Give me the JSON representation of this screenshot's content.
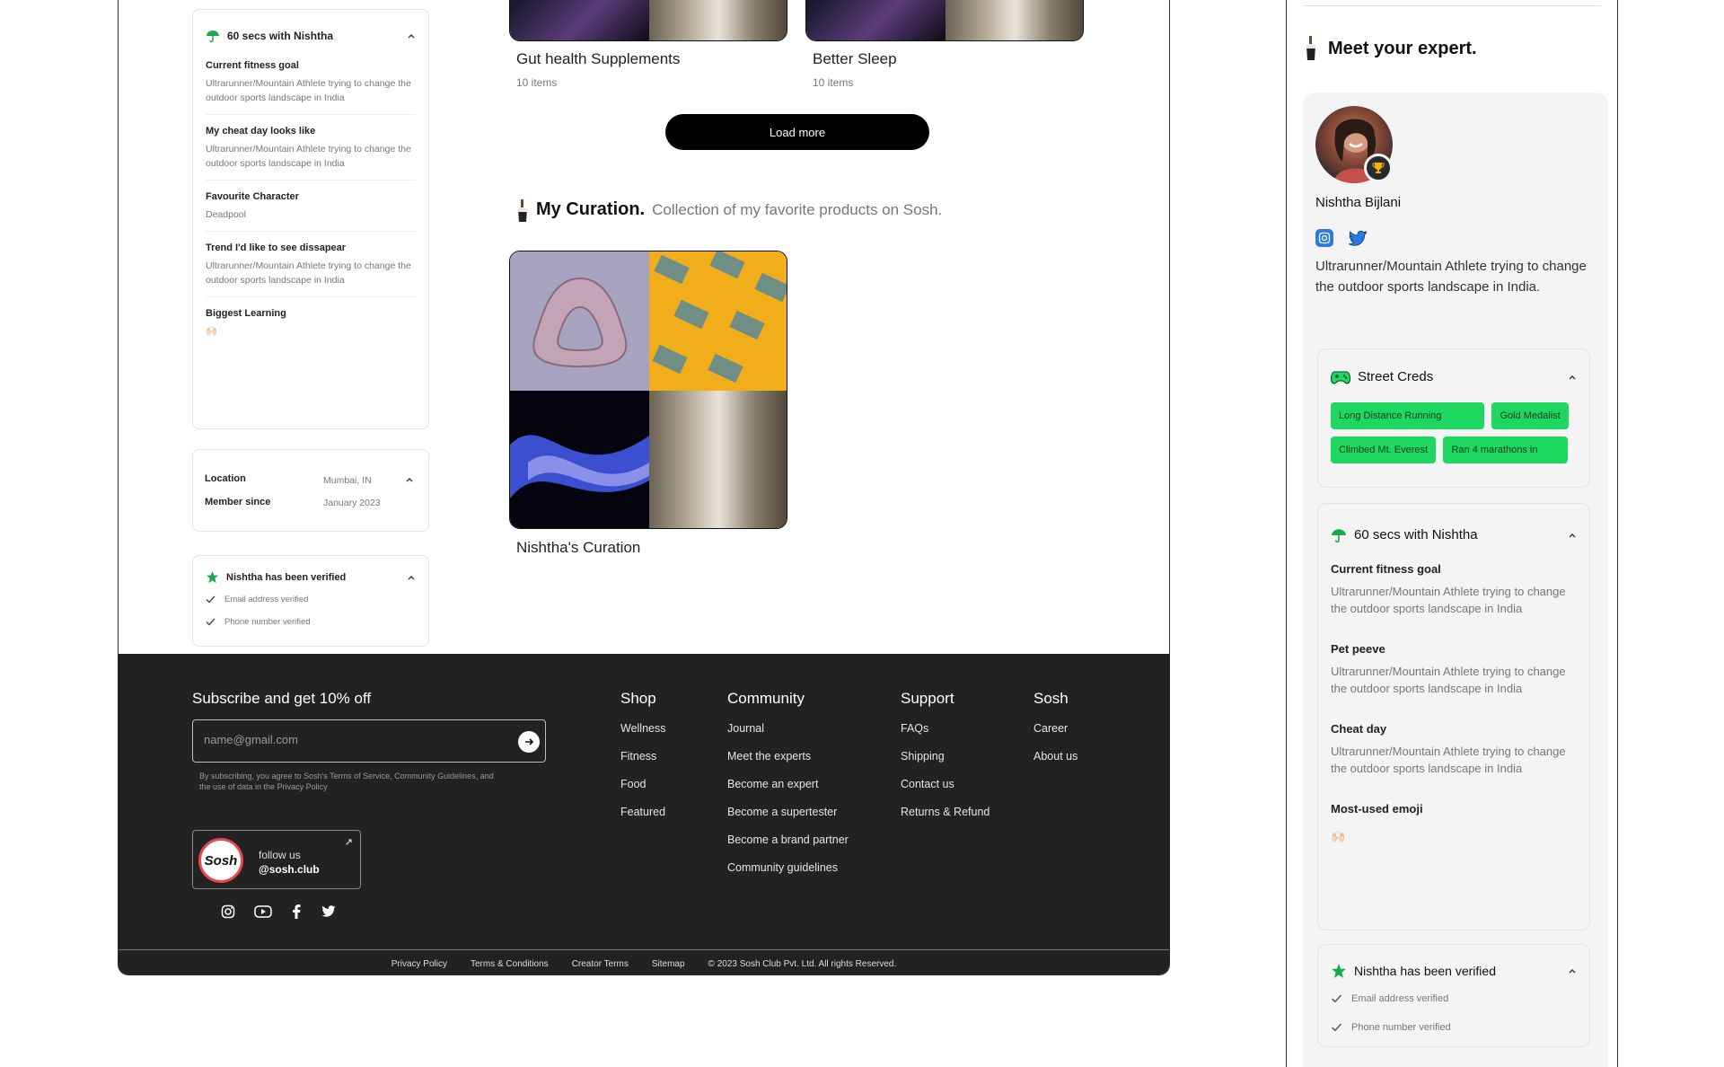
{
  "left": {
    "sixty_secs": {
      "title": "60 secs with Nishtha",
      "items": [
        {
          "q": "Current fitness goal",
          "a": "Ultrarunner/Mountain Athlete trying to change the outdoor sports landscape in India"
        },
        {
          "q": "My cheat day looks like",
          "a": "Ultrarunner/Mountain Athlete trying to change the outdoor sports landscape in India"
        },
        {
          "q": "Favourite Character",
          "a": "Deadpool"
        },
        {
          "q": "Trend I'd like to see dissapear",
          "a": "Ultrarunner/Mountain Athlete trying to change the outdoor sports landscape in India"
        },
        {
          "q": "Biggest Learning",
          "a": "🙌🏻"
        }
      ]
    },
    "info": {
      "location_label": "Location",
      "location_value": "Mumbai, IN",
      "member_label": "Member since",
      "member_value": "January 2023"
    },
    "verified": {
      "title": "Nishtha has been verified",
      "items": [
        "Email address verified",
        "Phone number verified"
      ]
    },
    "products": [
      {
        "title": "Gut health Supplements",
        "count": "10 items"
      },
      {
        "title": "Better Sleep",
        "count": "10 items"
      }
    ],
    "load_more": "Load more",
    "curation": {
      "heading": "My Curation.",
      "subheading": "Collection of my favorite products on Sosh.",
      "card_title": "Nishtha's Curation"
    }
  },
  "footer": {
    "subscribe_title": "Subscribe and get 10% off",
    "email_placeholder": "name@gmail.com",
    "fine_print": "By subscribing, you agree to Sosh's Terms of Service, Community Guidelines, and the use of data in the Privacy Policy",
    "follow_label": "follow us",
    "follow_handle": "@sosh.club",
    "logo_text": "Sosh",
    "columns": [
      {
        "heading": "Shop",
        "links": [
          "Wellness",
          "Fitness",
          "Food",
          "Featured"
        ]
      },
      {
        "heading": "Community",
        "links": [
          "Journal",
          "Meet the experts",
          "Become an expert",
          "Become a supertester",
          "Become a brand partner",
          "Community guidelines"
        ]
      },
      {
        "heading": "Support",
        "links": [
          "FAQs",
          "Shipping",
          "Contact us",
          "Returns & Refund"
        ]
      },
      {
        "heading": "Sosh",
        "links": [
          "Career",
          "About us"
        ]
      }
    ],
    "bottom_links": [
      "Privacy Policy",
      "Terms & Conditions",
      "Creator Terms",
      "Sitemap",
      "© 2023 Sosh Club Pvt. Ltd. All rights Reserved."
    ]
  },
  "mobile": {
    "heading": "Meet your expert.",
    "name": "Nishtha Bijlani",
    "bio": "Ultrarunner/Mountain Athlete trying to change the outdoor sports landscape in India.",
    "street_creds": {
      "title": "Street Creds",
      "tags": [
        "Long Distance Running",
        "Gold Medalist",
        "Climbed Mt. Everest",
        "Ran 4 marathons in"
      ]
    },
    "sixty_secs": {
      "title": "60 secs with Nishtha",
      "items": [
        {
          "q": "Current fitness goal",
          "a": "Ultrarunner/Mountain Athlete trying to change the outdoor sports landscape in India"
        },
        {
          "q": "Pet peeve",
          "a": "Ultrarunner/Mountain Athlete trying to change the outdoor sports landscape in India"
        },
        {
          "q": "Cheat day",
          "a": "Ultrarunner/Mountain Athlete trying to change the outdoor sports landscape in India"
        },
        {
          "q": "Most-used emoji",
          "a": "🙌🏻"
        }
      ]
    },
    "verified": {
      "title": "Nishtha has been verified",
      "items": [
        "Email address verified",
        "Phone number verified"
      ]
    }
  },
  "colors": {
    "accent_green": "#1ed760",
    "footer_bg": "#222222",
    "button_black": "#000000"
  }
}
